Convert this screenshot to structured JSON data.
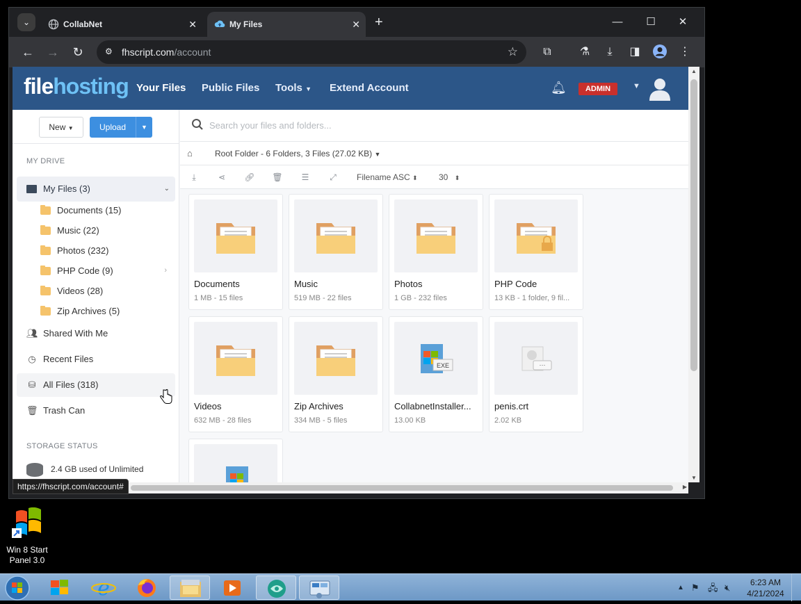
{
  "browser": {
    "tabs": [
      {
        "title": "CollabNet"
      },
      {
        "title": "My Files"
      }
    ],
    "url_host": "fhscript.com",
    "url_path": "/account",
    "status_url": "https://fhscript.com/account#"
  },
  "site": {
    "logo_a": "file",
    "logo_b": "hosting",
    "nav": [
      "Your Files",
      "Public Files",
      "Tools",
      "Extend Account"
    ],
    "admin_badge": "ADMIN"
  },
  "sidebar": {
    "new_label": "New",
    "upload_label": "Upload",
    "section_drive": "MY DRIVE",
    "my_files": "My Files (3)",
    "folders": [
      {
        "label": "Documents (15)"
      },
      {
        "label": "Music (22)"
      },
      {
        "label": "Photos (232)"
      },
      {
        "label": "PHP Code (9)"
      },
      {
        "label": "Videos (28)"
      },
      {
        "label": "Zip Archives (5)"
      }
    ],
    "links": [
      {
        "label": "Shared With Me"
      },
      {
        "label": "Recent Files"
      },
      {
        "label": "All Files (318)"
      },
      {
        "label": "Trash Can"
      }
    ],
    "section_storage": "STORAGE STATUS",
    "storage_text": "2.4 GB used of Unlimited"
  },
  "main": {
    "search_placeholder": "Search your files and folders...",
    "breadcrumb": "Root Folder - 6 Folders, 3 Files (27.02 KB)",
    "sort": "Filename ASC",
    "per_page": "30",
    "items": [
      {
        "name": "Documents",
        "meta": "1 MB - 15 files",
        "type": "folder"
      },
      {
        "name": "Music",
        "meta": "519 MB - 22 files",
        "type": "folder"
      },
      {
        "name": "Photos",
        "meta": "1 GB - 232 files",
        "type": "folder"
      },
      {
        "name": "PHP Code",
        "meta": "13 KB - 1 folder, 9 fil...",
        "type": "folder-locked"
      },
      {
        "name": "Videos",
        "meta": "632 MB - 28 files",
        "type": "folder"
      },
      {
        "name": "Zip Archives",
        "meta": "334 MB - 5 files",
        "type": "folder"
      },
      {
        "name": "CollabnetInstaller...",
        "meta": "13.00 KB",
        "type": "exe"
      },
      {
        "name": "penis.crt",
        "meta": "2.02 KB",
        "type": "cert"
      },
      {
        "name": "",
        "meta": "",
        "type": "exe-partial"
      }
    ],
    "exe_badge": "EXE"
  },
  "desktop": {
    "icon_label": "Win 8 Start Panel 3.0"
  },
  "taskbar": {
    "time": "6:23 AM",
    "date": "4/21/2024"
  }
}
